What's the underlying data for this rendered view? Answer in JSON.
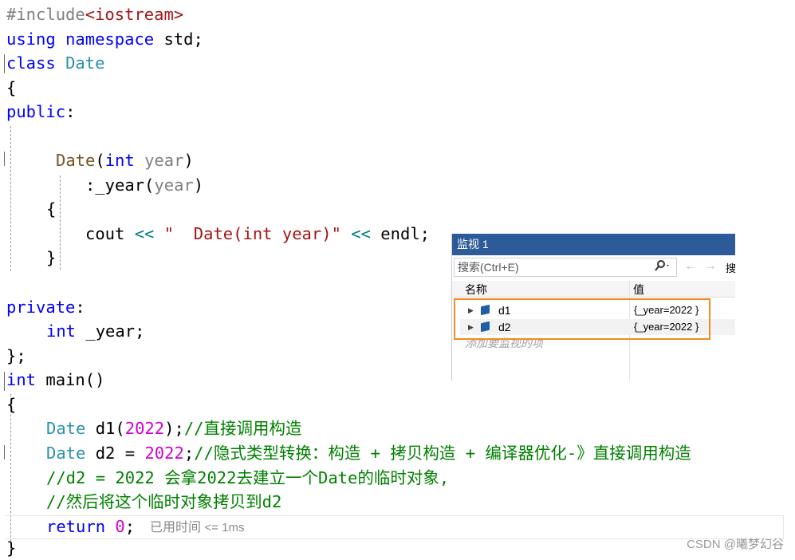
{
  "code": {
    "lines": [
      [
        "#include",
        "<iostream>"
      ],
      [
        "using",
        " ",
        "namespace",
        " std;"
      ],
      [
        "class",
        " ",
        "Date"
      ],
      [
        "{"
      ],
      [
        "public",
        ":"
      ],
      [
        ""
      ],
      [
        "Date",
        "(",
        "int",
        " ",
        "year",
        ")"
      ],
      [
        ":_year(",
        "year",
        ")"
      ],
      [
        "{"
      ],
      [
        "cout",
        " ",
        "<<",
        " ",
        "\"  Date(int year)\"",
        " ",
        "<<",
        " endl;"
      ],
      [
        "}"
      ],
      [
        ""
      ],
      [
        "private",
        ":"
      ],
      [
        "int",
        " _year;"
      ],
      [
        "};"
      ],
      [
        "int",
        " main()"
      ],
      [
        "{"
      ],
      [
        "Date",
        " d1(",
        "2022",
        ");",
        "//直接调用构造"
      ],
      [
        "Date",
        " d2 = ",
        "2022",
        ";",
        "//隐式类型转换：构造 + 拷贝构造 + 编译器优化-》直接调用构造"
      ],
      [
        "//d2 = 2022 会拿2022去建立一个Date的临时对象,"
      ],
      [
        "//然后将这个临时对象拷贝到d2"
      ],
      [
        "return",
        " ",
        "0",
        ";"
      ],
      [
        "}"
      ]
    ],
    "perf_hint": "已用时间",
    "perf_hint_value": "<= 1ms"
  },
  "watch": {
    "title": "监视 1",
    "search_placeholder": "搜索(Ctrl+E)",
    "search_icon": "search-icon",
    "back_icon": "←",
    "forward_icon": "→",
    "search_depth_label": "搜",
    "columns": {
      "name": "名称",
      "value": "值"
    },
    "rows": [
      {
        "name": "d1",
        "value": "{_year=2022 }"
      },
      {
        "name": "d2",
        "value": "{_year=2022 }"
      }
    ],
    "add_item_label": "添加要监视的项"
  },
  "watermark": "CSDN @曦梦幻谷",
  "colors": {
    "keyword": "#0000ff",
    "type": "#2b91af",
    "string": "#a31515",
    "number": "#d100d1",
    "comment": "#008000",
    "title_bar": "#2d5b9a",
    "highlight": "#f28a26"
  }
}
